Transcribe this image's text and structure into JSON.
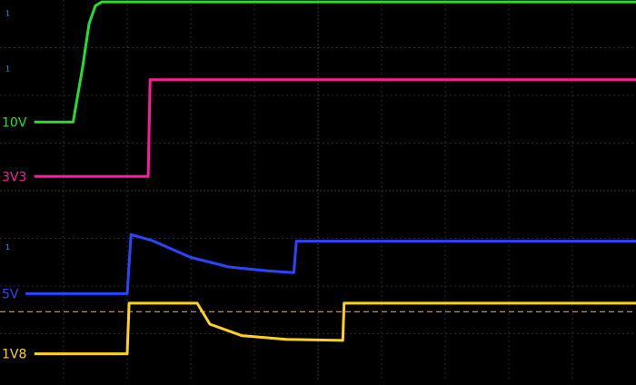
{
  "chart_data": {
    "type": "line",
    "title": "",
    "xlabel": "",
    "ylabel": "",
    "grid": true,
    "x_divisions": 10,
    "y_divisions": 8,
    "xlim": [
      0,
      10
    ],
    "ylim": [
      0,
      8
    ],
    "background": "#000000",
    "grid_color": "#3a3a3a",
    "threshold": {
      "y": 1.46,
      "color": "#e0862a",
      "style": "dashed"
    },
    "channel_markers": [
      {
        "text": "1",
        "color": "#2aa0ff",
        "y": 7.72
      },
      {
        "text": "1",
        "color": "#2aa0ff",
        "y": 6.56
      },
      {
        "text": "1",
        "color": "#2aa0ff",
        "y": 2.82
      }
    ],
    "series": [
      {
        "name": "10V",
        "color": "#22e02a",
        "marker_y": 5.44,
        "points": [
          [
            0.54,
            5.44
          ],
          [
            1.15,
            5.44
          ],
          [
            1.3,
            6.6
          ],
          [
            1.4,
            7.5
          ],
          [
            1.5,
            7.88
          ],
          [
            1.6,
            7.96
          ],
          [
            10,
            7.96
          ]
        ]
      },
      {
        "name": "3V3",
        "color": "#ff1a9c",
        "marker_y": 4.3,
        "points": [
          [
            0.54,
            4.3
          ],
          [
            2.33,
            4.3
          ],
          [
            2.36,
            6.33
          ],
          [
            10,
            6.33
          ]
        ]
      },
      {
        "name": "5V",
        "color": "#2b45ff",
        "marker_y": 1.84,
        "points": [
          [
            0.4,
            1.84
          ],
          [
            2.0,
            1.84
          ],
          [
            2.06,
            3.08
          ],
          [
            2.4,
            2.95
          ],
          [
            3.0,
            2.6
          ],
          [
            3.6,
            2.4
          ],
          [
            4.2,
            2.32
          ],
          [
            4.62,
            2.28
          ],
          [
            4.66,
            2.94
          ],
          [
            10,
            2.94
          ]
        ]
      },
      {
        "name": "1V8",
        "color": "#ffd21a",
        "marker_y": 0.58,
        "points": [
          [
            0.54,
            0.58
          ],
          [
            2.0,
            0.58
          ],
          [
            2.03,
            1.64
          ],
          [
            3.1,
            1.64
          ],
          [
            3.3,
            1.2
          ],
          [
            3.8,
            0.96
          ],
          [
            4.5,
            0.88
          ],
          [
            5.39,
            0.86
          ],
          [
            5.41,
            1.64
          ],
          [
            10,
            1.64
          ]
        ]
      }
    ]
  }
}
